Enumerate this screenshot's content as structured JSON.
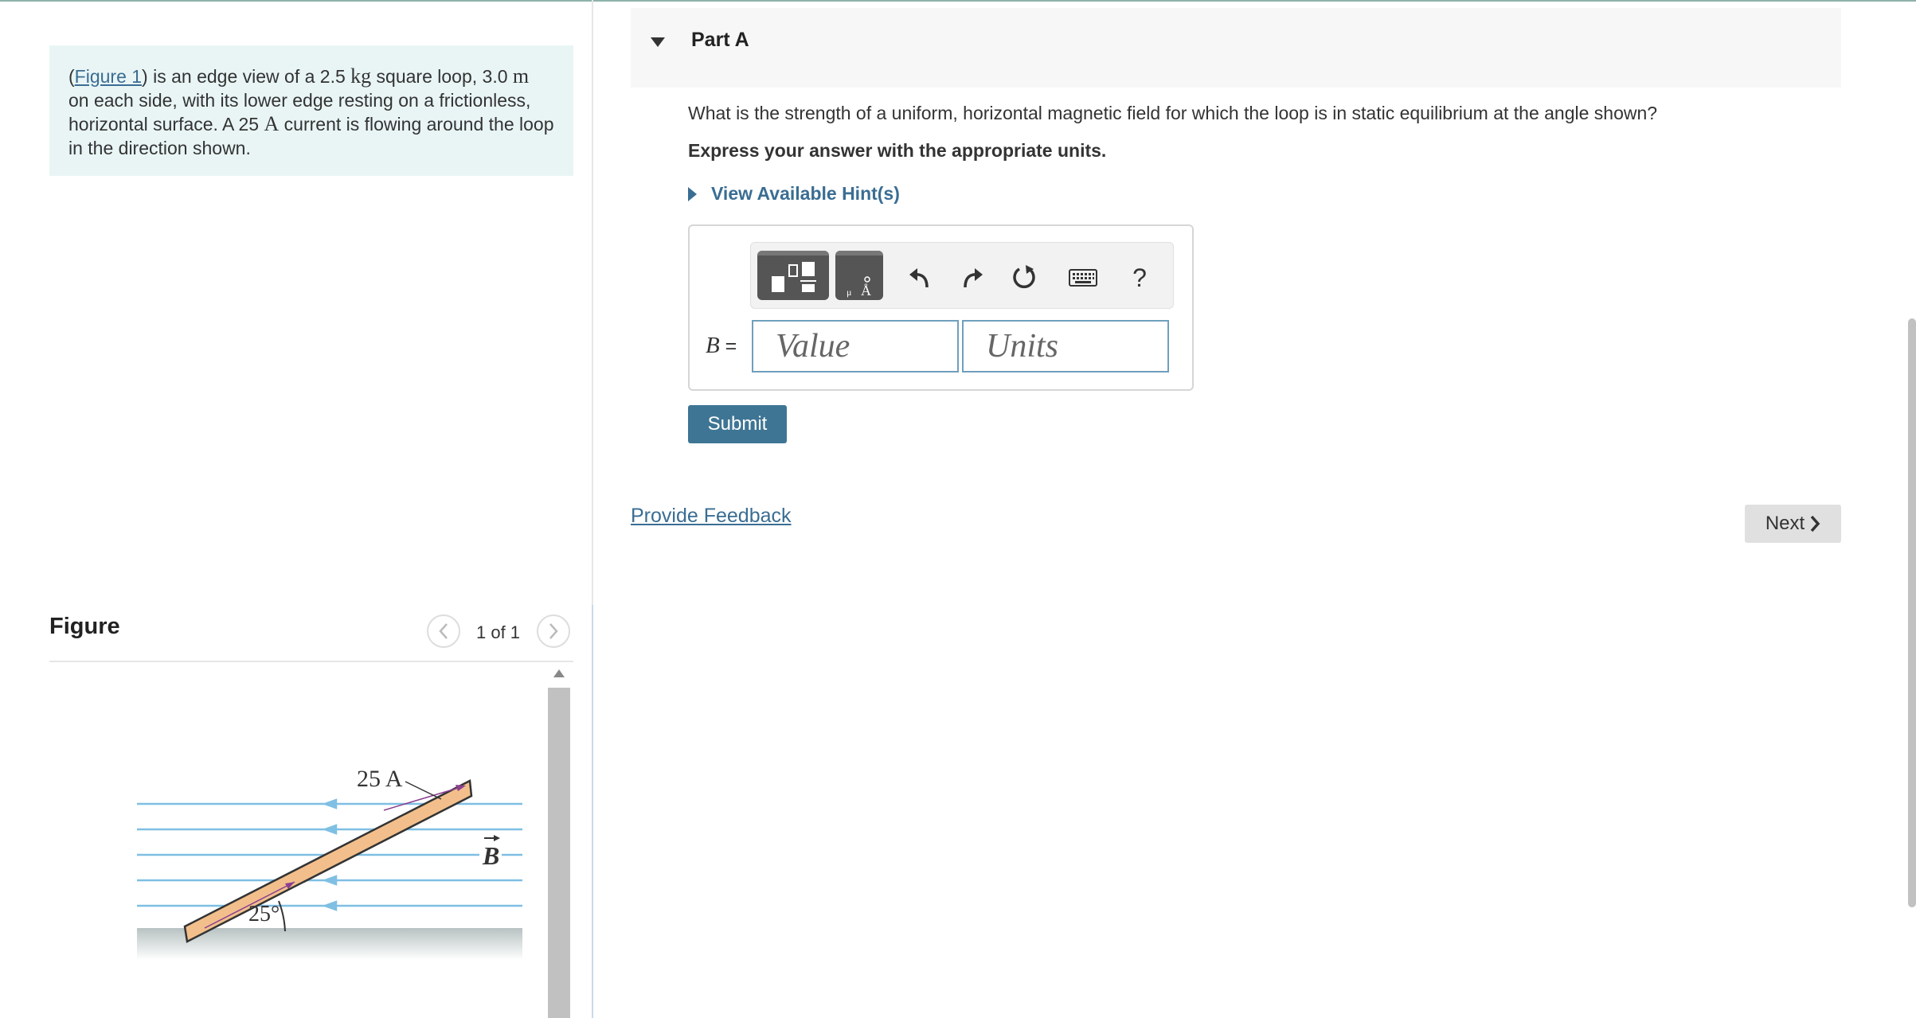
{
  "problem": {
    "figure_link": "Figure 1",
    "text_1": ") is an edge view of a ",
    "mass": "2.5",
    "mass_unit": "kg",
    "text_2": " square loop, ",
    "side": "3.0",
    "side_unit": "m",
    "text_3": " on each side, with its lower edge resting on a frictionless, horizontal surface. A ",
    "current": "25",
    "current_unit": "A",
    "text_4": " current is flowing around the loop in the direction shown."
  },
  "figure_panel": {
    "title": "Figure",
    "pager": "1 of 1",
    "diagram": {
      "current_label": "25 A",
      "field_label": "B",
      "angle_label": "25°"
    }
  },
  "part": {
    "title": "Part A",
    "question": "What is the strength of a uniform, horizontal magnetic field for which the loop is in static equilibrium at the angle shown?",
    "instruction": "Express your answer with the appropriate units.",
    "hint_label": "View Available Hint(s)",
    "variable": "B",
    "equals": " =",
    "value_placeholder": "Value",
    "units_placeholder": "Units",
    "help_label": "?",
    "submit_label": "Submit"
  },
  "footer": {
    "feedback_label": "Provide Feedback",
    "next_label": "Next"
  },
  "colors": {
    "accent": "#3e7594",
    "link": "#3a6d93",
    "intro_bg": "#e9f5f5",
    "field_line": "#7fbfe3",
    "loop_fill": "#f2bf8c"
  }
}
